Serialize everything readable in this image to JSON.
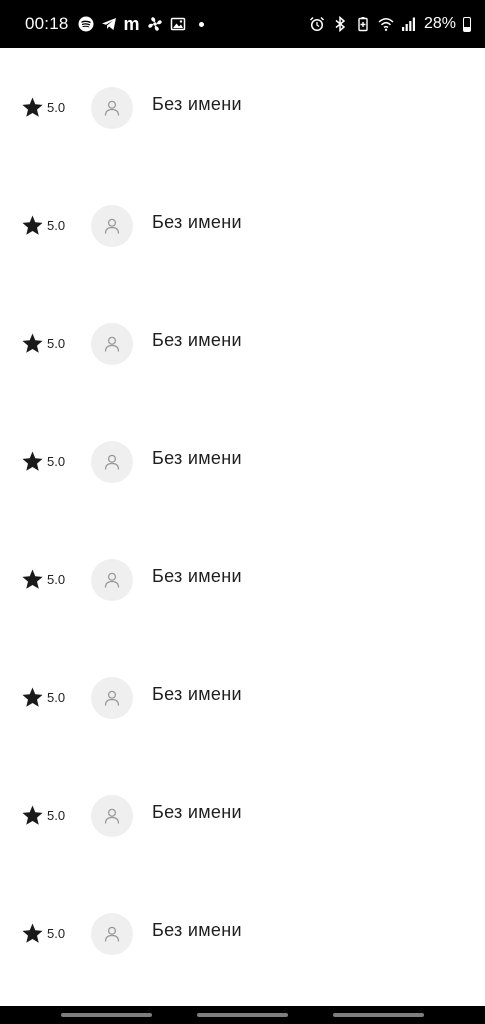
{
  "status_bar": {
    "time": "00:18",
    "battery_percent": "28%",
    "left_icons": [
      "spotify-icon",
      "telegram-icon",
      "m-app-icon",
      "fan-icon",
      "gallery-icon"
    ],
    "right_icons": [
      "alarm-icon",
      "bluetooth-icon",
      "battery-saver-icon",
      "wifi-icon",
      "signal-icon"
    ],
    "m_letter": "m"
  },
  "reviews": [
    {
      "rating": "5.0",
      "name": "Без имени"
    },
    {
      "rating": "5.0",
      "name": "Без имени"
    },
    {
      "rating": "5.0",
      "name": "Без имени"
    },
    {
      "rating": "5.0",
      "name": "Без имени"
    },
    {
      "rating": "5.0",
      "name": "Без имени"
    },
    {
      "rating": "5.0",
      "name": "Без имени"
    },
    {
      "rating": "5.0",
      "name": "Без имени"
    },
    {
      "rating": "5.0",
      "name": "Без имени"
    }
  ],
  "colors": {
    "status_bar_bg": "#000000",
    "text": "#1f1f1f",
    "avatar_bg": "#efefef",
    "star": "#1a1a1a"
  }
}
